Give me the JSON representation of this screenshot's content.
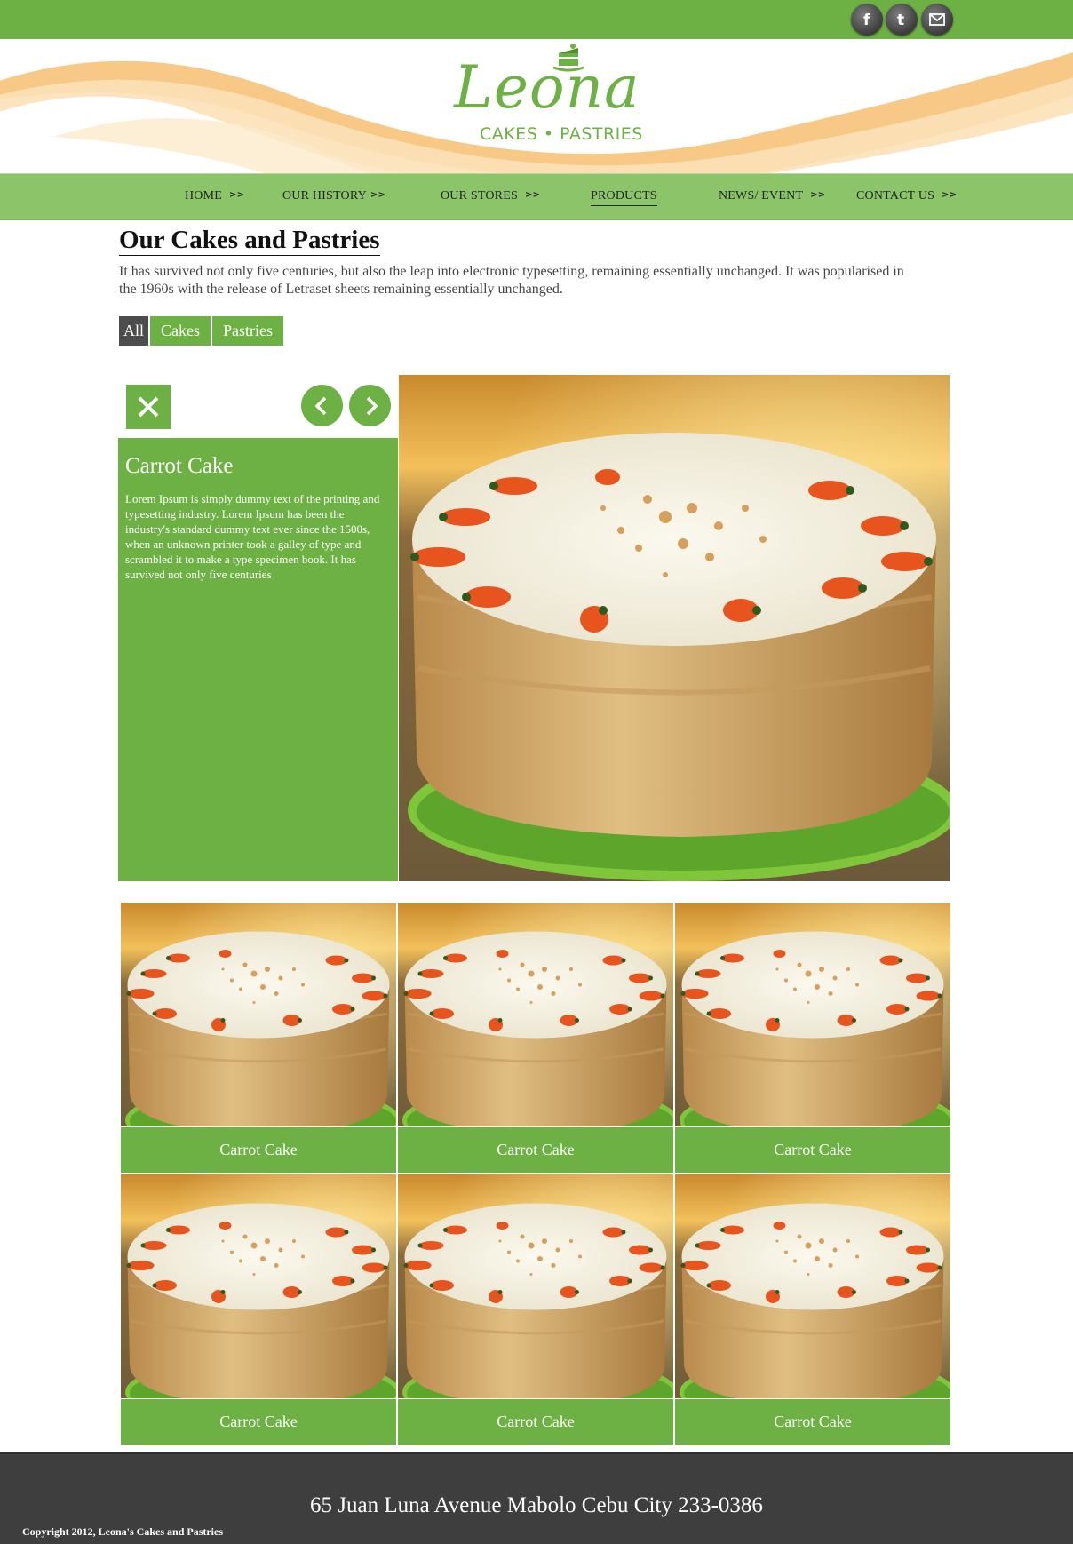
{
  "brand": {
    "name": "Leona",
    "tagline": "CAKES • PASTRIES",
    "primary_color": "#6db144",
    "nav_color": "#8cc46a",
    "footer_color": "#3e3e3e"
  },
  "social": [
    {
      "name": "facebook-icon",
      "glyph": "f"
    },
    {
      "name": "twitter-icon",
      "glyph": "t"
    },
    {
      "name": "mail-icon",
      "glyph": "mail"
    }
  ],
  "nav": {
    "items": [
      {
        "label": "HOME",
        "arrow": ">>"
      },
      {
        "label": "OUR HISTORY",
        "arrow": ">>"
      },
      {
        "label": "OUR STORES",
        "arrow": ">>"
      },
      {
        "label": "PRODUCTS",
        "arrow": ""
      },
      {
        "label": "NEWS/ EVENT",
        "arrow": ">>"
      },
      {
        "label": "CONTACT US",
        "arrow": ">>"
      }
    ],
    "active": "PRODUCTS"
  },
  "main": {
    "title": "Our Cakes and Pastries",
    "intro": "It has survived not only five centuries, but also the leap into electronic typesetting, remaining essentially unchanged. It was popularised in the 1960s with the release of Letraset sheets remaining essentially unchanged.",
    "filters": [
      "All",
      "Cakes",
      "Pastries"
    ],
    "active_filter": "All"
  },
  "feature": {
    "title": "Carrot Cake",
    "description": "Lorem Ipsum is simply dummy text of the printing and typesetting industry. Lorem Ipsum has been the industry's standard dummy text ever since the 1500s, when an unknown printer took a galley of type and scrambled it to make a type specimen book. It has survived not only five centuries"
  },
  "products": [
    {
      "caption": "Carrot Cake"
    },
    {
      "caption": "Carrot Cake"
    },
    {
      "caption": "Carrot Cake"
    },
    {
      "caption": "Carrot Cake"
    },
    {
      "caption": "Carrot Cake"
    },
    {
      "caption": "Carrot Cake"
    }
  ],
  "footer": {
    "address": "65 Juan Luna Avenue Mabolo Cebu City 233-0386",
    "copyright": "Copyright 2012, Leona's Cakes and Pastries"
  }
}
